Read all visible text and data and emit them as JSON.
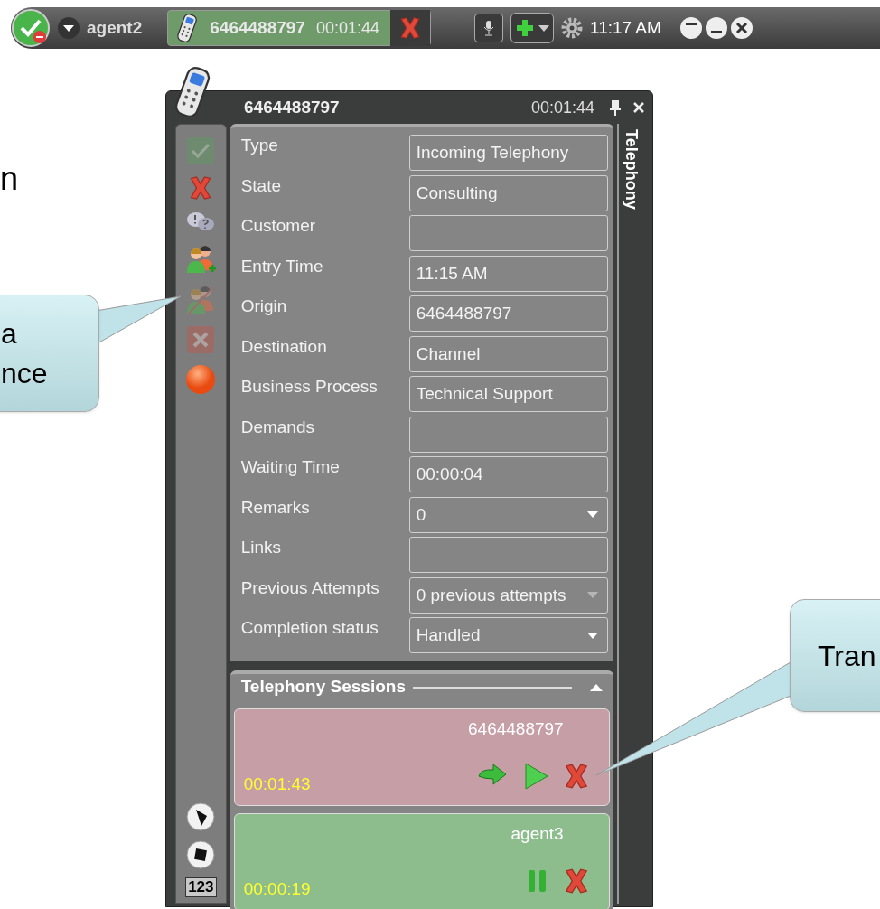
{
  "top_bar": {
    "agent": "agent2",
    "call": {
      "number": "6464488797",
      "duration": "00:01:44"
    },
    "clock": "11:17 AM"
  },
  "window": {
    "title": "6464488797",
    "duration": "00:01:44",
    "side_tab": "Telephony"
  },
  "toolbar": [
    {
      "kind": "check",
      "disabled": true
    },
    {
      "kind": "cross",
      "disabled": false
    },
    {
      "kind": "chat",
      "disabled": false
    },
    {
      "kind": "add-people",
      "disabled": false
    },
    {
      "kind": "people-off",
      "disabled": true
    },
    {
      "kind": "cross-box",
      "disabled": true
    },
    {
      "kind": "record",
      "disabled": false
    }
  ],
  "toolbar_bottom": [
    {
      "kind": "dial"
    },
    {
      "kind": "dial-stop"
    },
    {
      "kind": "keypad",
      "label": "123"
    }
  ],
  "fields": [
    {
      "label": "Type",
      "value": "Incoming Telephony",
      "kind": "text"
    },
    {
      "label": "State",
      "value": "Consulting",
      "kind": "text"
    },
    {
      "label": "Customer",
      "kind": "text"
    },
    {
      "label": "Entry Time",
      "value": "11:15 AM",
      "kind": "text"
    },
    {
      "label": "Origin",
      "value": "6464488797",
      "kind": "text"
    },
    {
      "label": "Destination",
      "value": "Channel",
      "kind": "text"
    },
    {
      "label": "Business Process",
      "value": "Technical Support",
      "kind": "text"
    },
    {
      "label": "Demands",
      "kind": "text"
    },
    {
      "label": "Waiting Time",
      "value": "00:00:04",
      "kind": "text"
    },
    {
      "label": "Remarks",
      "value": "0",
      "kind": "dropdown"
    },
    {
      "label": "Links",
      "kind": "text"
    },
    {
      "label": "Previous Attempts",
      "value": "0 previous attempts",
      "kind": "dropdown"
    },
    {
      "label": "Completion status",
      "value": "Handled",
      "kind": "dropdown"
    }
  ],
  "sessions": {
    "title": "Telephony Sessions",
    "items": [
      {
        "name": "6464488797",
        "time": "00:01:43",
        "color": "#c59ea6",
        "actions": [
          {
            "kind": "transfer"
          },
          {
            "kind": "play"
          },
          {
            "kind": "end"
          }
        ]
      },
      {
        "name": "agent3",
        "time": "00:00:19",
        "color": "#8dbd8c",
        "actions": [
          {
            "kind": "pause"
          },
          {
            "kind": "end"
          }
        ]
      }
    ]
  },
  "background_text": "n",
  "callouts": [
    {
      "kind": "left",
      "lines": [
        "a",
        "nce"
      ]
    },
    {
      "kind": "right",
      "lines": [
        "Tran"
      ]
    }
  ]
}
